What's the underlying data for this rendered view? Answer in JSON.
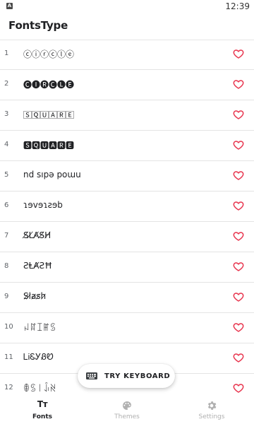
{
  "status_bar": {
    "icon_letter": "A",
    "time": "12:39"
  },
  "app_bar": {
    "title": "FontsType"
  },
  "fonts": [
    {
      "number": "1",
      "sample": "ⓒⓘⓡⓒⓛⓔ",
      "favorite": false
    },
    {
      "number": "2",
      "sample": "🅒🅘🅡🅒🅛🅔",
      "favorite": false
    },
    {
      "number": "3",
      "sample": "🅂🅀🅄🄰🅁🄴",
      "favorite": false
    },
    {
      "number": "4",
      "sample": "🆂🆀🆄🅰🆁🅴",
      "favorite": false
    },
    {
      "number": "5",
      "sample": "nd sıpə poɯu",
      "favorite": false
    },
    {
      "number": "6",
      "sample": "ɿɘvɘɿƨɘb",
      "favorite": false
    },
    {
      "number": "7",
      "sample": "S̸L̸A̸S̸H̸",
      "favorite": false
    },
    {
      "number": "8",
      "sample": "ƧⱠȺƧĦ",
      "favorite": false
    },
    {
      "number": "9",
      "sample": "S̷l̷a̷s̷h̷",
      "favorite": false
    },
    {
      "number": "10",
      "sample": "ꈤꍏꀤꂵꌗ",
      "favorite": false
    },
    {
      "number": "11",
      "sample": "ᏞᎥᏋᎩᏰᏬ",
      "favorite": false
    },
    {
      "number": "12",
      "sample": "ꂦꌗ꒐ꀭꋊ",
      "favorite": false
    }
  ],
  "floating_button": {
    "label": "TRY KEYBOARD"
  },
  "bottom_nav": {
    "items": [
      {
        "label": "Fonts",
        "icon": "text-format-icon",
        "icon_text": "Tт",
        "active": true
      },
      {
        "label": "Themes",
        "icon": "palette-icon",
        "active": false
      },
      {
        "label": "Settings",
        "icon": "gear-icon",
        "active": false
      }
    ]
  },
  "colors": {
    "heart": "#e8364f",
    "inactive_nav": "#b0b0b0",
    "text": "#202124"
  }
}
